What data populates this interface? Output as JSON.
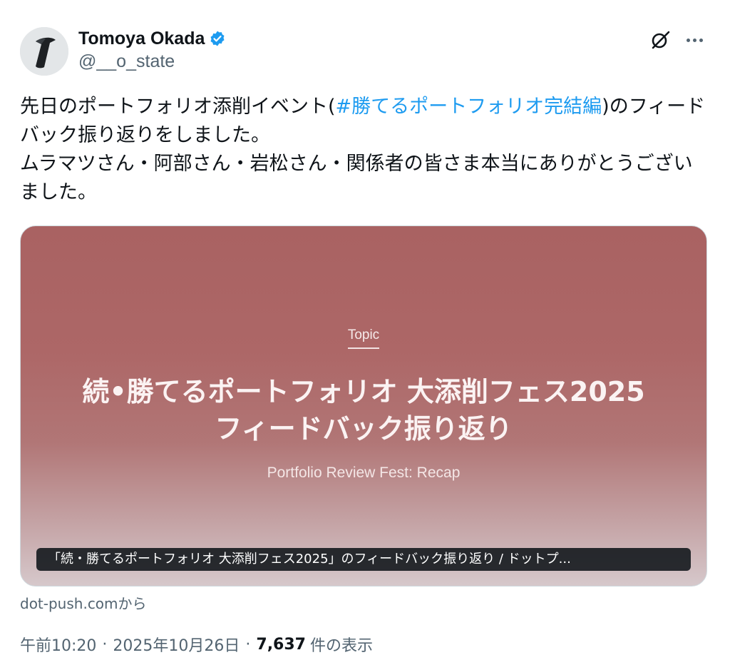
{
  "author": {
    "display_name": "Tomoya Okada",
    "handle": "@__o_state",
    "verified_color": "#1d9bf0"
  },
  "actions": {
    "grok_icon": "grok-icon",
    "more_icon": "more-icon"
  },
  "body": {
    "line1_pre": "先日のポートフォリオ添削イベント(",
    "hashtag": "#勝てるポートフォリオ完結編",
    "line1_post": ")のフィードバック振り返りをしました。",
    "line2": "ムラマツさん・阿部さん・岩松さん・関係者の皆さま本当にありがとうございました。"
  },
  "card": {
    "topic": "Topic",
    "headline_line1": "続•勝てるポートフォリオ 大添削フェス2025",
    "headline_line2": "フィードバック振り返り",
    "subtitle": "Portfolio Review Fest: Recap",
    "caption": "「続・勝てるポートフォリオ 大添削フェス2025」のフィードバック振り返り / ドットプ...",
    "source": "dot-push.comから"
  },
  "meta": {
    "time": "午前10:20",
    "sep1": "·",
    "date": "2025年10月26日",
    "sep2": "·",
    "views_count": "7,637",
    "views_label": "件の表示"
  },
  "colors": {
    "link": "#1d9bf0",
    "secondary_text": "#536471",
    "primary_text": "#0f1419",
    "card_bg": "#ad6767"
  }
}
